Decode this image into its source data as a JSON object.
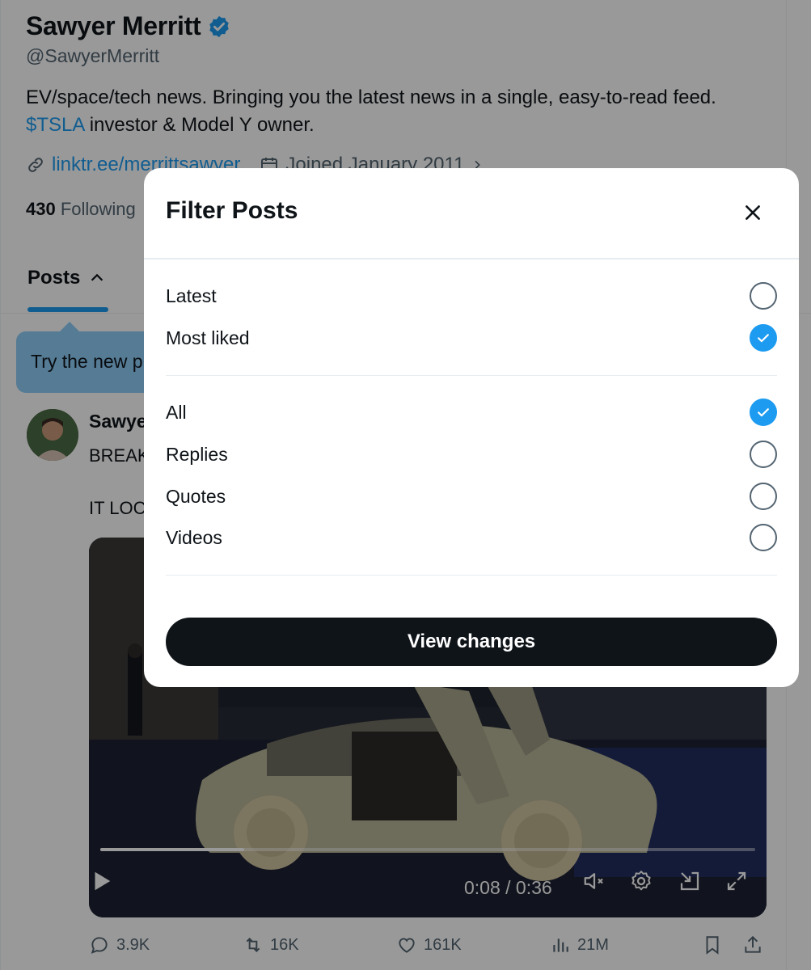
{
  "profile": {
    "name": "Sawyer Merritt",
    "handle": "@SawyerMerritt",
    "bio_line1": "EV/space/tech news. Bringing you the latest news in a single, easy-to-read feed.",
    "bio_cashtag": "$TSLA",
    "bio_line2_rest": " investor & Model Y owner.",
    "website": "linktr.ee/merrittsawyer",
    "joined": "Joined January 2011",
    "following_count": "430",
    "following_label": "Following"
  },
  "tabs": {
    "posts_label": "Posts"
  },
  "tooltip": {
    "text": "Try the new p"
  },
  "post": {
    "author_partial": "Sawye",
    "line1_partial": "BREAK",
    "line2_partial": "IT LOC",
    "video": {
      "time": "0:08 / 0:36",
      "progress": 0.22
    },
    "actions": {
      "replies": "3.9K",
      "reposts": "16K",
      "likes": "161K",
      "views": "21M"
    }
  },
  "modal": {
    "title": "Filter Posts",
    "sort_options": [
      {
        "label": "Latest",
        "checked": false
      },
      {
        "label": "Most liked",
        "checked": true
      }
    ],
    "type_options": [
      {
        "label": "All",
        "checked": true
      },
      {
        "label": "Replies",
        "checked": false
      },
      {
        "label": "Quotes",
        "checked": false
      },
      {
        "label": "Videos",
        "checked": false
      }
    ],
    "submit_label": "View changes"
  },
  "colors": {
    "accent": "#1d9bf0",
    "text": "#0f1419",
    "muted": "#536471",
    "button_bg": "#0f1419",
    "tooltip_bg": "#8ecdf8"
  },
  "icons": {
    "verified": "verified-badge-icon",
    "link": "link-icon",
    "calendar": "calendar-icon",
    "chevron_up": "chevron-up-icon",
    "close": "close-icon",
    "check": "check-icon",
    "play": "play-icon",
    "mute": "mute-icon",
    "settings": "gear-icon",
    "pip": "picture-in-picture-icon",
    "fullscreen": "fullscreen-icon",
    "reply": "reply-icon",
    "repost": "repost-icon",
    "like": "heart-icon",
    "views": "views-icon",
    "bookmark": "bookmark-icon",
    "share": "share-icon"
  }
}
